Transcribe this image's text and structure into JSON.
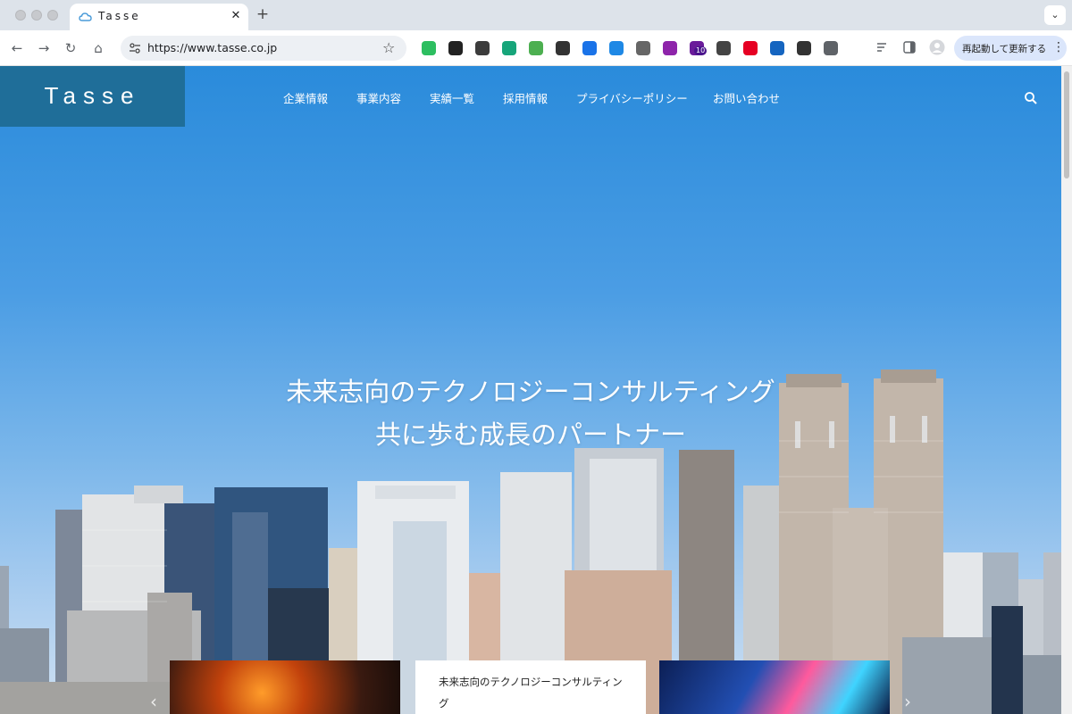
{
  "browser": {
    "tab": {
      "title": "Tasse",
      "close": "✕"
    },
    "new_tab": "+",
    "tab_menu": "⌄",
    "nav": {
      "back": "←",
      "forward": "→",
      "reload": "↻",
      "home": "⌂"
    },
    "address": {
      "url": "https://www.tasse.co.jp",
      "star": "☆"
    },
    "extensions": [
      {
        "name": "evernote",
        "color": "#2dbe60"
      },
      {
        "name": "amazon",
        "color": "#222222"
      },
      {
        "name": "dots",
        "color": "#3c3c3c"
      },
      {
        "name": "aqua-a",
        "color": "#17a57a"
      },
      {
        "name": "clover",
        "color": "#4caf50"
      },
      {
        "name": "mask",
        "color": "#333333"
      },
      {
        "name": "blue-badge",
        "color": "#1a73e8"
      },
      {
        "name": "s-swirl",
        "color": "#1e88e5"
      },
      {
        "name": "camera",
        "color": "#666666"
      },
      {
        "name": "puzzle-chart",
        "color": "#8e24aa"
      },
      {
        "name": "house-10",
        "color": "#6a1b9a"
      },
      {
        "name": "rw",
        "color": "#444444"
      },
      {
        "name": "pinterest",
        "color": "#e60023"
      },
      {
        "name": "window-blue",
        "color": "#1565c0"
      },
      {
        "name": "layout",
        "color": "#333333"
      },
      {
        "name": "puzzle",
        "color": "#5f6368"
      }
    ],
    "badge_count": "10",
    "update_button": {
      "label": "再起動して更新する",
      "menu": "⋮"
    }
  },
  "site": {
    "logo": "Tasse",
    "nav": [
      "企業情報",
      "事業内容",
      "実績一覧",
      "採用情報",
      "プライバシーポリシー",
      "お問い合わせ"
    ],
    "hero": {
      "line1": "未来志向のテクノロジーコンサルティング",
      "line2": "共に歩む成長のパートナー"
    },
    "card": {
      "text": "未来志向のテクノロジーコンサルティング"
    },
    "slider": {
      "prev": "‹",
      "next": "›"
    }
  },
  "colors": {
    "logo_bg": "#1f6e99",
    "sky_top": "#2a8bdb",
    "update_bg": "#dbe6fb"
  }
}
